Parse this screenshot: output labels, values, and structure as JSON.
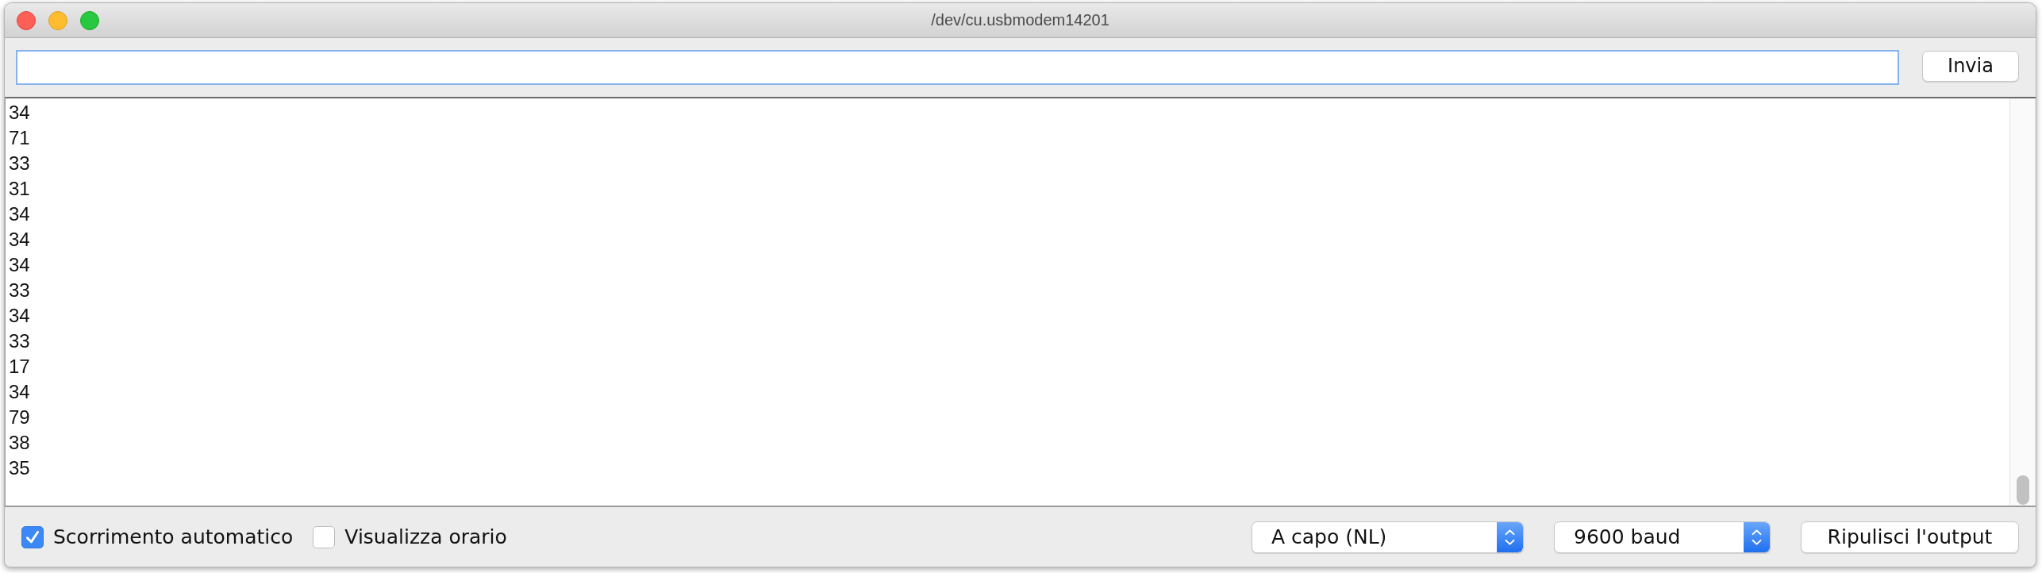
{
  "window": {
    "title": "/dev/cu.usbmodem14201"
  },
  "send_field": {
    "focused": true
  },
  "send_button": {
    "label": "Invia"
  },
  "output": {
    "lines": [
      "34",
      "71",
      "33",
      "31",
      "34",
      "34",
      "34",
      "33",
      "34",
      "33",
      "17",
      "34",
      "79",
      "38",
      "35"
    ]
  },
  "footer": {
    "checkboxes": [
      {
        "label": "Scorrimento automatico",
        "checked": true
      },
      {
        "label": "Visualizza orario",
        "checked": false
      }
    ],
    "dropdowns": [
      {
        "value": "A capo (NL)"
      },
      {
        "value": "9600 baud"
      }
    ],
    "clear_button": {
      "label": "Ripulisci l'output"
    }
  }
}
